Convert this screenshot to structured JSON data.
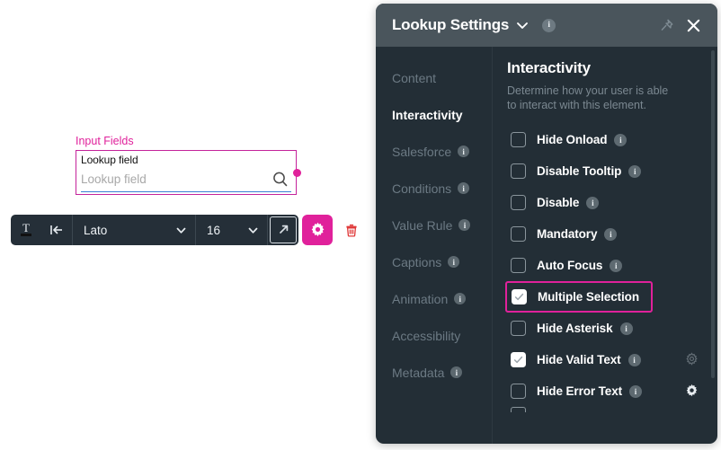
{
  "canvas": {
    "group_label": "Input Fields",
    "field_caption": "Lookup field",
    "field_placeholder": "Lookup field",
    "search_icon": "search-icon",
    "selection_color": "#c4239b",
    "underline_color": "#3a7fd5"
  },
  "toolbar": {
    "text_color_icon": "text-color-icon",
    "indent_icon": "indent-left-icon",
    "font_family": "Lato",
    "font_size": "16",
    "expand_icon": "external-link-icon",
    "settings_icon": "gear-icon",
    "delete_icon": "trash-icon",
    "settings_bg": "#e0219b",
    "delete_color": "#e03a3a"
  },
  "panel": {
    "title": "Lookup Settings",
    "caret_icon": "chevron-down-icon",
    "info_icon": "info-icon",
    "pin_icon": "pin-icon",
    "close_icon": "close-icon",
    "nav": [
      {
        "label": "Content",
        "active": false,
        "info": false
      },
      {
        "label": "Interactivity",
        "active": true,
        "info": false
      },
      {
        "label": "Salesforce",
        "active": false,
        "info": true
      },
      {
        "label": "Conditions",
        "active": false,
        "info": true
      },
      {
        "label": "Value Rule",
        "active": false,
        "info": true
      },
      {
        "label": "Captions",
        "active": false,
        "info": true
      },
      {
        "label": "Animation",
        "active": false,
        "info": true
      },
      {
        "label": "Accessibility",
        "active": false,
        "info": false
      },
      {
        "label": "Metadata",
        "active": false,
        "info": true
      }
    ],
    "content": {
      "title": "Interactivity",
      "subtitle": "Determine how your user is able to interact with this element.",
      "options": [
        {
          "label": "Hide Onload",
          "checked": false,
          "info": true,
          "gear": false,
          "highlighted": false
        },
        {
          "label": "Disable Tooltip",
          "checked": false,
          "info": true,
          "gear": false,
          "highlighted": false
        },
        {
          "label": "Disable",
          "checked": false,
          "info": true,
          "gear": false,
          "highlighted": false
        },
        {
          "label": "Mandatory",
          "checked": false,
          "info": true,
          "gear": false,
          "highlighted": false
        },
        {
          "label": "Auto Focus",
          "checked": false,
          "info": true,
          "gear": false,
          "highlighted": false
        },
        {
          "label": "Multiple Selection",
          "checked": true,
          "info": false,
          "gear": false,
          "highlighted": true
        },
        {
          "label": "Hide Asterisk",
          "checked": false,
          "info": true,
          "gear": false,
          "highlighted": false
        },
        {
          "label": "Hide Valid Text",
          "checked": true,
          "info": true,
          "gear": true,
          "highlighted": false
        },
        {
          "label": "Hide Error Text",
          "checked": false,
          "info": true,
          "gear": true,
          "highlighted": false
        }
      ],
      "highlight_color": "#e0219b"
    }
  }
}
